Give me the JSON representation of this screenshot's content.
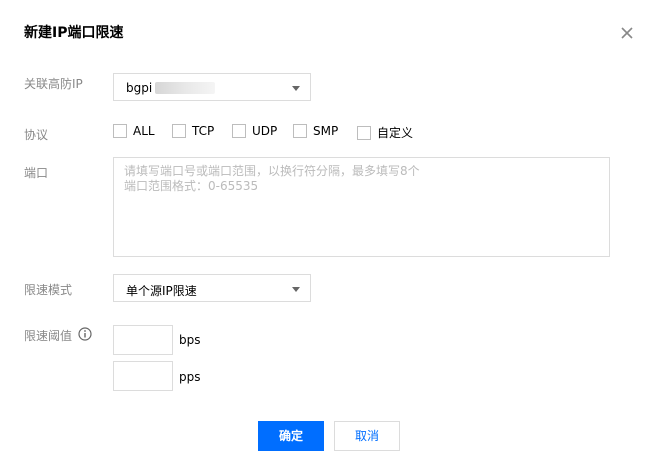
{
  "dialog": {
    "title": "新建IP端口限速",
    "close_icon": "close-icon"
  },
  "form": {
    "ip": {
      "label": "关联高防IP",
      "value": "bgpi"
    },
    "protocol": {
      "label": "协议",
      "options": [
        {
          "label": "ALL",
          "checked": false
        },
        {
          "label": "TCP",
          "checked": false
        },
        {
          "label": "UDP",
          "checked": false
        },
        {
          "label": "SMP",
          "checked": false
        },
        {
          "label": "自定义",
          "checked": false
        }
      ]
    },
    "port": {
      "label": "端口",
      "placeholder_line1": "请填写端口号或端口范围，以换行符分隔，最多填写8个",
      "placeholder_line2": "端口范围格式：0-65535"
    },
    "mode": {
      "label": "限速模式",
      "value": "单个源IP限速"
    },
    "threshold": {
      "label": "限速阈值",
      "info_icon": "info-icon",
      "unit_bps": "bps",
      "unit_pps": "pps"
    }
  },
  "buttons": {
    "confirm": "确定",
    "cancel": "取消"
  },
  "colors": {
    "primary": "#006eff",
    "label": "#888888",
    "border": "#dcdcdc"
  }
}
